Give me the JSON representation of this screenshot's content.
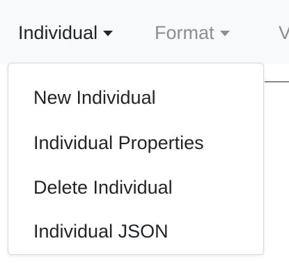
{
  "menubar": {
    "menus": [
      {
        "label": "Individual",
        "state": "open"
      },
      {
        "label": "Format",
        "state": "closed"
      },
      {
        "label": "V",
        "state": "closed"
      }
    ]
  },
  "dropdown": {
    "items": [
      {
        "label": "New Individual"
      },
      {
        "label": "Individual Properties"
      },
      {
        "label": "Delete Individual"
      },
      {
        "label": "Individual JSON"
      }
    ]
  },
  "colors": {
    "menubar_bg": "#f8f9fa",
    "active_text": "#212529",
    "inactive_text": "#8a8f95",
    "dropdown_border": "#d5d8dc"
  }
}
